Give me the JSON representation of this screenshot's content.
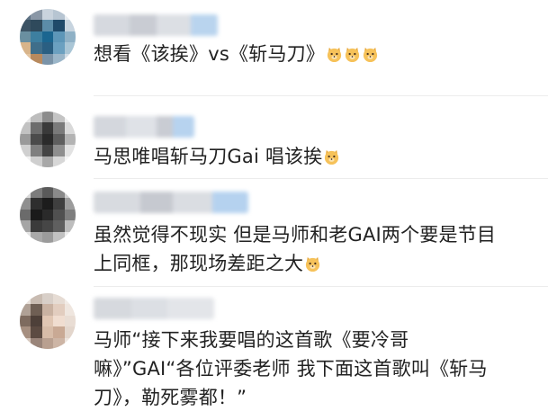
{
  "comments": [
    {
      "text_lines": [
        "想看《该挨》vs《斩马刀》"
      ],
      "emoji_count": 3
    },
    {
      "text_lines": [
        "马思唯唱斩马刀Gai 唱该挨"
      ],
      "emoji_count": 1
    },
    {
      "text_lines": [
        "虽然觉得不现实 但是马师和老GAI两个要是节目",
        "上同框，那现场差距之大"
      ],
      "emoji_count": 1
    },
    {
      "text_lines": [
        "马师“接下来我要唱的这首歌《要冷哥",
        "嘛》”GAI“各位评委老师 我下面这首歌叫《斩马",
        "刀》，勒死雾都！”"
      ],
      "emoji_count": 0
    }
  ],
  "emoji_icon": "doge-emoji-icon",
  "colors": {
    "text": "#222222",
    "divider": "#ececec",
    "emoji_face": "#f6c25a"
  }
}
